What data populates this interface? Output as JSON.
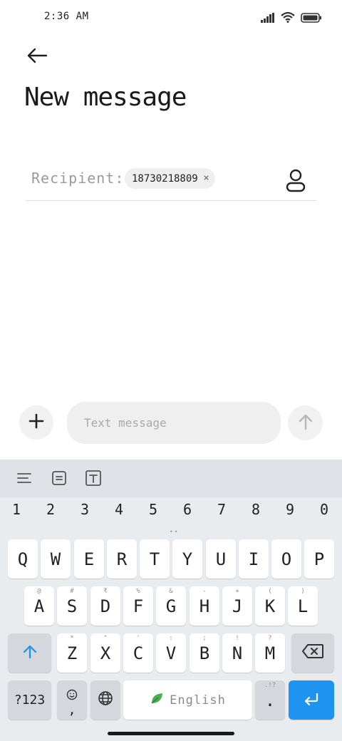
{
  "status_bar": {
    "time": "2:36 AM"
  },
  "header": {
    "title": "New message",
    "back_icon": "arrow-left-icon"
  },
  "recipient": {
    "label": "Recipient:",
    "chip_value": "18730218809",
    "chip_close": "×",
    "contact_icon": "person-icon"
  },
  "composer": {
    "placeholder": "Text message",
    "attach_icon": "plus-icon",
    "send_icon": "arrow-up-icon"
  },
  "keyboard": {
    "toolbar": [
      "menu-lines-icon",
      "document-icon",
      "text-box-icon"
    ],
    "numbers": [
      "1",
      "2",
      "3",
      "4",
      "5",
      "6",
      "7",
      "8",
      "9",
      "0"
    ],
    "row1": [
      {
        "key": "Q",
        "hint": ""
      },
      {
        "key": "W",
        "hint": ""
      },
      {
        "key": "E",
        "hint": ""
      },
      {
        "key": "R",
        "hint": ""
      },
      {
        "key": "T",
        "hint": ""
      },
      {
        "key": "Y",
        "hint": ""
      },
      {
        "key": "U",
        "hint": ""
      },
      {
        "key": "I",
        "hint": ""
      },
      {
        "key": "O",
        "hint": ""
      },
      {
        "key": "P",
        "hint": ""
      }
    ],
    "row2": [
      {
        "key": "A",
        "hint": "@"
      },
      {
        "key": "S",
        "hint": "#"
      },
      {
        "key": "D",
        "hint": "₹"
      },
      {
        "key": "F",
        "hint": "%"
      },
      {
        "key": "G",
        "hint": "&"
      },
      {
        "key": "H",
        "hint": "-"
      },
      {
        "key": "J",
        "hint": "+"
      },
      {
        "key": "K",
        "hint": "("
      },
      {
        "key": "L",
        "hint": ")"
      }
    ],
    "row3": [
      {
        "key": "Z",
        "hint": "*"
      },
      {
        "key": "X",
        "hint": "\""
      },
      {
        "key": "C",
        "hint": "'"
      },
      {
        "key": "V",
        "hint": ":"
      },
      {
        "key": "B",
        "hint": ";"
      },
      {
        "key": "N",
        "hint": "!"
      },
      {
        "key": "M",
        "hint": "?"
      }
    ],
    "symbols_label": "?123",
    "emoji_hint": ",",
    "space_label": "English",
    "period_label": ".",
    "period_hint": ".!?",
    "accent_color": "#1e93ef"
  }
}
